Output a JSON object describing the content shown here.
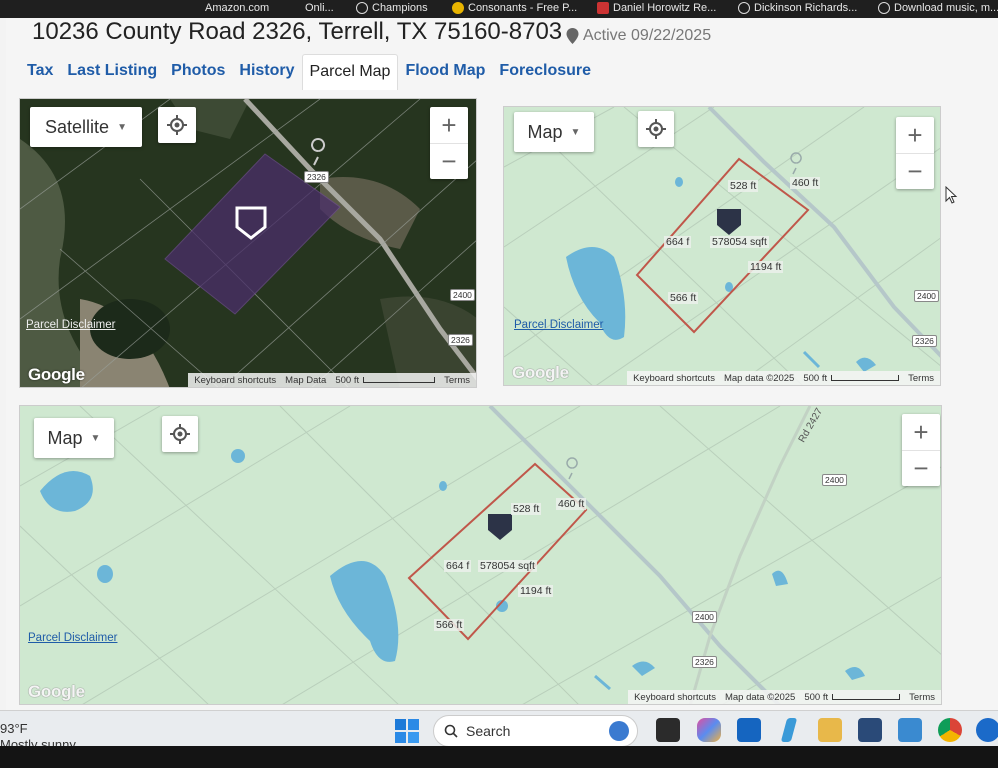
{
  "browser": {
    "bookmarks": [
      {
        "label": "Amazon.com"
      },
      {
        "label": "Onli..."
      },
      {
        "label": "Champions"
      },
      {
        "label": "Consonants - Free P..."
      },
      {
        "label": "Daniel Horowitz Re..."
      },
      {
        "label": "Dickinson Richards..."
      },
      {
        "label": "Download music, m..."
      }
    ]
  },
  "header": {
    "address": "10236 County Road 2326, Terrell, TX 75160-8703",
    "status": "Active 09/22/2025"
  },
  "tabs": [
    {
      "label": "Tax",
      "active": false
    },
    {
      "label": "Last Listing",
      "active": false
    },
    {
      "label": "Photos",
      "active": false
    },
    {
      "label": "History",
      "active": false
    },
    {
      "label": "Parcel Map",
      "active": true
    },
    {
      "label": "Flood Map",
      "active": false
    },
    {
      "label": "Foreclosure",
      "active": false
    }
  ],
  "maps": {
    "satellite": {
      "type_label": "Satellite",
      "disclaimer": "Parcel Disclaimer",
      "logo": "Google",
      "road_labels": [
        "2326",
        "2400",
        "2326"
      ],
      "footer": {
        "shortcuts": "Keyboard shortcuts",
        "data": "Map Data",
        "scale": "500 ft",
        "terms": "Terms"
      }
    },
    "top": {
      "type_label": "Map",
      "disclaimer": "Parcel Disclaimer",
      "logo": "Google",
      "road_labels": [
        "2400",
        "2326"
      ],
      "parcel_labels": {
        "top": "528 ft",
        "right_top": "460 ft",
        "left": "664 f",
        "area": "578054 sqft",
        "right": "1194 ft",
        "bottom": "566 ft"
      },
      "footer": {
        "shortcuts": "Keyboard shortcuts",
        "data": "Map data ©2025",
        "scale": "500 ft",
        "terms": "Terms"
      }
    },
    "bottom": {
      "type_label": "Map",
      "disclaimer": "Parcel Disclaimer",
      "logo": "Google",
      "road_name": "Rd 2427",
      "road_labels": [
        "2400",
        "2400",
        "2326"
      ],
      "parcel_labels": {
        "top": "528 ft",
        "right_top": "460 ft",
        "left": "664 f",
        "area": "578054 sqft",
        "right": "1194 ft",
        "bottom": "566 ft"
      },
      "footer": {
        "shortcuts": "Keyboard shortcuts",
        "data": "Map data ©2025",
        "scale": "500 ft",
        "terms": "Terms"
      }
    }
  },
  "taskbar": {
    "temperature": "93°F",
    "condition": "Mostly sunny",
    "search_label": "Search"
  },
  "colors": {
    "link": "#1f5ca8",
    "parcel_outline": "#c0574a",
    "map_green": "#cfe8d0",
    "water": "#6cb6d8"
  }
}
